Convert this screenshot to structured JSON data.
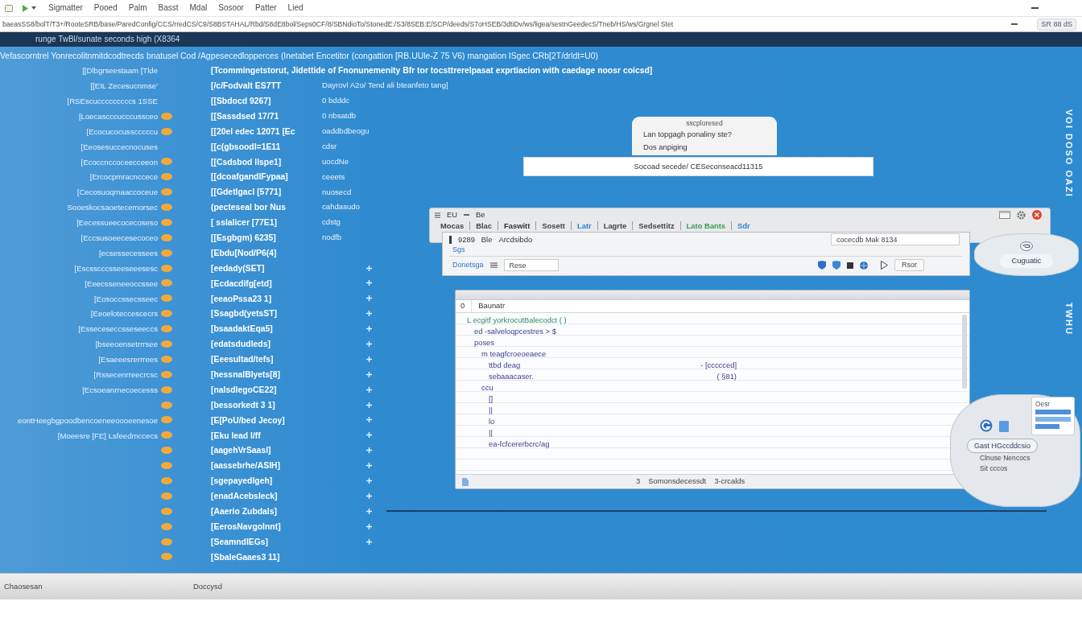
{
  "menu_bar": {
    "items": [
      "Sigmatter",
      "Pooed",
      "Palm",
      "Basst",
      "Mdal",
      "Sosoor",
      "Patter",
      "Lied"
    ]
  },
  "path_bar": {
    "path": "baeasSS8/bolT/T3+/RooteSRB/base/ParedConfig/CCS/rredCS/C9/S8BSTAHAL/Rbd/S8dE8bol/Seps0CF/8/SBNdioTo/StonedE:/S3/8SEB:E/SCP/deeds/S7oHSEB/3dtiDv/ws/ligea/sestnGeedecS/Tneb/HS/ws/Grgnel Stet",
    "tools": "SR 88 dS"
  },
  "header_bar": {
    "title": "runge TwBl/sunate seconds high (X8364"
  },
  "console": {
    "intro": "Vefascorntrel Yonrecolitnmitdcodtrecds bnatusel Cod /Agpesecedlopperces (Inetabet Encetitor (congattion [RB.UUle-Z 75 V6) mangation ISgec CRb[2T/drldt=U0)",
    "rows": [
      {
        "left": "[[Dlbgrseestaam [Tlde",
        "middle": "[Tcommingetstorut, Jidettide of Fnonunemenity Bfr tor tocsttrerelpasat exprtiacion with caedage noosr coicsd]",
        "flagged": false,
        "ticked": false
      },
      {
        "left": "[[EIL Zecesucnmse'",
        "middle": "[/c/Fodvalt ES7TT",
        "right": "Dayrovl A2o/ Tend ali bteanfeto tang]",
        "flagged": false,
        "ticked": false
      },
      {
        "left": "[RSEscucccccccccs 1SSE",
        "middle": "[[Sbdocd 9267]",
        "right": "0 bdddc",
        "flagged": false,
        "ticked": false
      },
      {
        "left": "[Loecascccucccussceo",
        "middle": "[[Sassdsed 17/71",
        "right": "0 nbsatdb",
        "flagged": true,
        "ticked": false
      },
      {
        "left": "[Ecocucocusscccccu",
        "middle": "[[20el edec 12071 [Ec",
        "right": "oaddbdbeogu",
        "flagged": true,
        "ticked": false
      },
      {
        "left": "[Eeosesuccecnocuses",
        "middle": "[[c(gbsoodl=1E11",
        "right": "cdsr",
        "flagged": false,
        "ticked": false
      },
      {
        "left": "[Ecoccnccoceecceeon",
        "middle": "[[Csdsbod llspe1]",
        "right": "uocdNe",
        "flagged": true,
        "ticked": false
      },
      {
        "left": "[Ercocpmracnccece",
        "middle": "[[dcoafgandlFypaa]",
        "right": "ceeets",
        "flagged": true,
        "ticked": false
      },
      {
        "left": "[Cecosuoqmaaccoceue",
        "middle": "[[Gdetlgacl [5771]",
        "right": "nuosecd",
        "flagged": true,
        "ticked": false
      },
      {
        "left": "Sooeskocsaoetecemorsec",
        "middle": "(pecteseal bor Nus",
        "right": "cahdasudo",
        "flagged": true,
        "ticked": false
      },
      {
        "left": "[Eecessueecocecoseso",
        "middle": "[ sslalicer [77E1]",
        "right": "cdstg",
        "flagged": true,
        "ticked": false
      },
      {
        "left": "[Eccsusoeecesecoceo",
        "middle": "[[Esgbgm) 6235]",
        "right": "nodfb",
        "flagged": true,
        "ticked": false
      },
      {
        "left": "[ecsessecessees",
        "middle": "[Ebdu[Nod/P6(4]",
        "flagged": true,
        "ticked": false
      },
      {
        "left": "[Escsscccsseeseeesesc",
        "middle": "[eedady(SET]",
        "flagged": true,
        "ticked": true
      },
      {
        "left": "[Eeecsseneeoccssee",
        "middle": "[Ecdacdifg[etd]",
        "flagged": true,
        "ticked": true
      },
      {
        "left": "[Eosoccssecsseec",
        "middle": "[eeaoPssa23 1]",
        "flagged": true,
        "ticked": true
      },
      {
        "left": "[Eeoeloteccescecrs",
        "middle": "[Ssagbd(yetsST]",
        "flagged": true,
        "ticked": true
      },
      {
        "left": "[Esseceseccsseseeccs",
        "middle": "[bsaadaktEqa5]",
        "flagged": true,
        "ticked": true
      },
      {
        "left": "[bseeoensetrrrsee",
        "middle": "[edatsdudleds]",
        "flagged": true,
        "ticked": true
      },
      {
        "left": "[Esaeeesrerrrees",
        "middle": "[Eeesultad/tefs]",
        "flagged": true,
        "ticked": true
      },
      {
        "left": "[Rssecenrreecrcsc",
        "middle": "[hessnalBlyets[8]",
        "flagged": true,
        "ticked": true
      },
      {
        "left": "[Ecsoeanrnecoecesss",
        "middle": "[nalsdlegoCE22]",
        "flagged": true,
        "ticked": true
      },
      {
        "middle": "[bessorkedt 3 1]",
        "flagged": true,
        "ticked": true
      },
      {
        "left": "eontHeegbgpoodbencoeneeoooeenesoe",
        "middle": "[E[PoU/bed Jecoy]",
        "flagged": true,
        "ticked": true
      },
      {
        "left": "[Moeesre [FE] Lsfeedmccecs",
        "middle": "[Eku lead l/ff",
        "flagged": true,
        "ticked": true
      },
      {
        "middle": "[aagehVrSaasl]",
        "flagged": true,
        "ticked": true
      },
      {
        "middle": "[aassebrhe/ASIH]",
        "flagged": true,
        "ticked": true
      },
      {
        "middle": "[sgepayedlgeh]",
        "flagged": true,
        "ticked": true
      },
      {
        "middle": "[enadAcebsleck]",
        "flagged": true,
        "ticked": true
      },
      {
        "middle": "[Aaerio Zubdals]",
        "flagged": true,
        "ticked": true
      },
      {
        "middle": "[EerosNavgolnnt]",
        "flagged": true,
        "ticked": true
      },
      {
        "middle": "[SeamndlEGs]",
        "flagged": true,
        "ticked": true
      },
      {
        "middle": "[SbaleGaaes3 11]",
        "flagged": true,
        "ticked": false
      }
    ]
  },
  "popup": {
    "title": "sscploresed",
    "lines": [
      "Lan topgagh ponaliny ste?",
      "Dos anpiging"
    ]
  },
  "message_bar": {
    "text": "Socoad secede/ CESeconseacd11315"
  },
  "app_window": {
    "title_items": [
      "EU",
      "Be"
    ],
    "tabs": [
      {
        "label": "Mocas",
        "color": "#444444"
      },
      {
        "label": "Blac",
        "color": "#444444"
      },
      {
        "label": "Faswitt",
        "color": "#333333"
      },
      {
        "label": "Sosett",
        "color": "#444444"
      },
      {
        "label": "Latr",
        "color": "#2f7fd6"
      },
      {
        "label": "Lagrte",
        "color": "#444444"
      },
      {
        "label": "Sedsettitz",
        "color": "#444444"
      },
      {
        "label": "Lato Bants",
        "color": "#3a9a5a"
      },
      {
        "label": "Sdr",
        "color": "#2f7fd6"
      }
    ]
  },
  "tool_panel": {
    "number": "9289",
    "labels": [
      "Ble",
      "Arcdsibdo"
    ],
    "link": "Sgs",
    "search": {
      "value": "cocecdb Mak 8134"
    },
    "action_link": "Donetsga",
    "field": {
      "value": "Rese"
    },
    "button": "Rsor"
  },
  "callout_top": {
    "label": "Cuguatic"
  },
  "side_labels": [
    "VOI DOSO OAZI",
    "TWHU"
  ],
  "editor": {
    "header": [
      "0",
      "Baunatr"
    ],
    "lines": [
      {
        "text": "L ecgitf yorkrocutBalecodct ( )",
        "kind": "highlight",
        "children": [
          {
            "text": "ed -salveloqpcestres > $",
            "kind": "code"
          },
          {
            "text": "poses",
            "kind": "code",
            "children": [
              {
                "text": "m teagfcroeoeaece",
                "kind": "code",
                "children": [
                  {
                    "text": "ttbd deag",
                    "note": "- [ccccced]",
                    "kind": "code"
                  },
                  {
                    "text": "sebaaacaser.",
                    "note": "( §81)",
                    "kind": "code"
                  }
                ]
              },
              {
                "text": "ccu",
                "kind": "code",
                "children": [
                  {
                    "text": "[]",
                    "kind": "code"
                  },
                  {
                    "text": "||",
                    "kind": "code"
                  },
                  {
                    "text": "lo",
                    "kind": "code"
                  },
                  {
                    "text": "||",
                    "kind": "code"
                  },
                  {
                    "text": "ea-fcfcererbcrc/ag",
                    "kind": "code"
                  }
                ]
              }
            ]
          }
        ]
      }
    ],
    "status": [
      "3",
      "Somonsdecessdt",
      "3-crcalds"
    ]
  },
  "callout_bottom": {
    "card_title": "Oesr",
    "button": "Gast HGccddcsio",
    "lines": [
      "Clnuse Nencocs",
      "Sit cccos"
    ]
  },
  "status_bar": {
    "items": [
      "Chaosesan",
      "Doccysd"
    ]
  }
}
